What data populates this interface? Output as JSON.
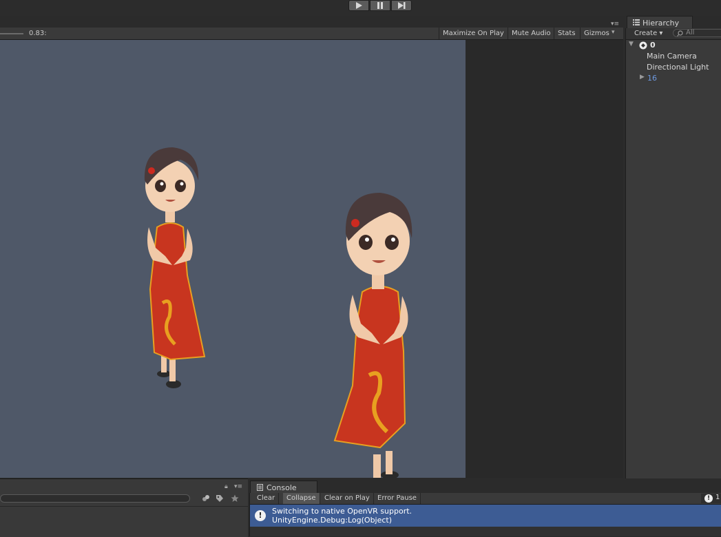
{
  "toolbar": {
    "play_icon": "play-icon",
    "pause_icon": "pause-icon",
    "step_icon": "step-icon"
  },
  "game": {
    "scale_value": "0.83:",
    "buttons": [
      "Maximize On Play",
      "Mute Audio",
      "Stats",
      "Gizmos"
    ],
    "dropdown_glyph": "▾",
    "menu_glyph": "▾≡",
    "background": "#4f5868"
  },
  "hierarchy": {
    "tab_label": "Hierarchy",
    "create_label": "Create ▾",
    "search_placeholder": "All",
    "scene_name": "0",
    "items": [
      "Main Camera",
      "Directional Light"
    ],
    "prefab_item": "16",
    "prefab_color": "#6e9ae0"
  },
  "console": {
    "tab_label": "Console",
    "buttons": [
      "Clear",
      "Collapse",
      "Clear on Play",
      "Error Pause"
    ],
    "count": "1",
    "message_line1": "Switching to native OpenVR support.",
    "message_line2": "UnityEngine.Debug:Log(Object)",
    "selected_color": "#3d5c94"
  },
  "characters": [
    {
      "name": "character-left",
      "dress_color": "#c8351f",
      "hair_color": "#4a3a3a"
    },
    {
      "name": "character-right",
      "dress_color": "#c8351f",
      "hair_color": "#4a3a3a"
    }
  ]
}
